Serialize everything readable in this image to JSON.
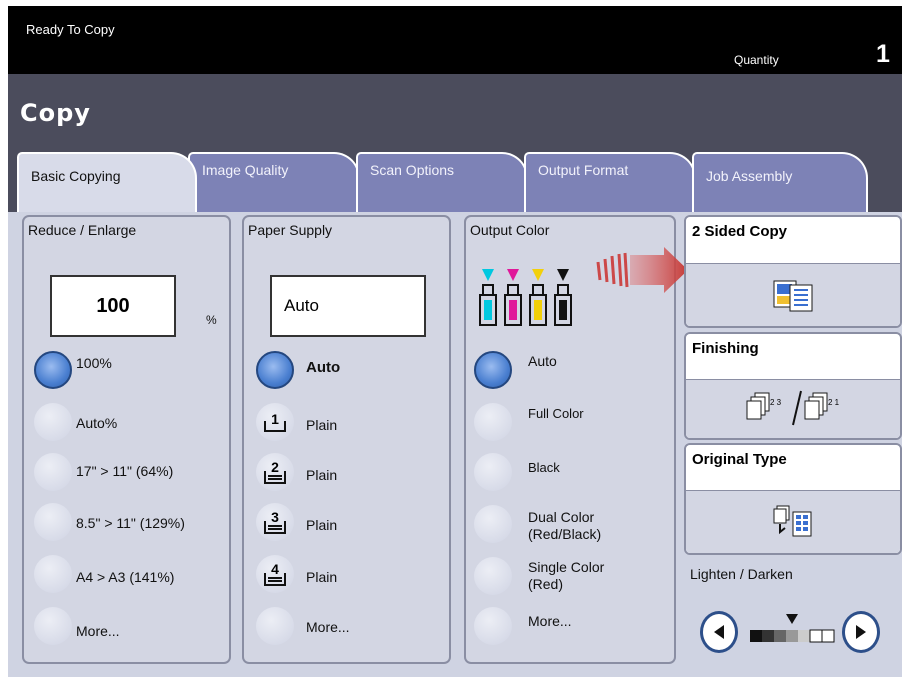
{
  "header": {
    "status": "Ready To Copy",
    "quantity_label": "Quantity",
    "quantity_value": "1"
  },
  "title": "Copy",
  "tabs": [
    {
      "label": "Basic Copying",
      "active": true
    },
    {
      "label": "Image Quality"
    },
    {
      "label": "Scan Options"
    },
    {
      "label": "Output Format"
    },
    {
      "label": "Job Assembly"
    }
  ],
  "reduce_enlarge": {
    "title": "Reduce / Enlarge",
    "value": "100",
    "unit": "%",
    "options": [
      "100%",
      "Auto%",
      "17\"  >  11\" (64%)",
      "8.5\" > 11\" (129%)",
      "A4 > A3 (141%)",
      "More..."
    ]
  },
  "paper_supply": {
    "title": "Paper Supply",
    "value": "Auto",
    "options": [
      "Auto",
      "Plain",
      "Plain",
      "Plain",
      "Plain",
      "More..."
    ],
    "trays": [
      "1",
      "2",
      "3",
      "4"
    ]
  },
  "output_color": {
    "title": "Output Color",
    "options": [
      "Auto",
      "Full Color",
      "Black",
      "Dual Color\n(Red/Black)",
      "Single Color\n(Red)",
      "More..."
    ]
  },
  "features": {
    "two_sided": "2 Sided Copy",
    "finishing": "Finishing",
    "original_type": "Original Type",
    "lighten_darken": "Lighten / Darken",
    "finishing_icon_text_left": "2 3",
    "finishing_icon_text_right": "2 1"
  },
  "colors": {
    "accent": "#7d82b6",
    "title_bar": "#4b4c5c",
    "selected": "#4a7fd0"
  }
}
